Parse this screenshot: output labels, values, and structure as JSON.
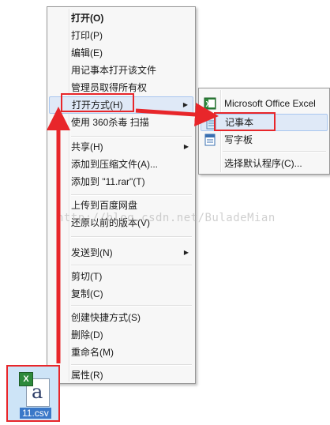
{
  "context_menu": {
    "items": [
      {
        "label": "打开(O)"
      },
      {
        "label": "打印(P)"
      },
      {
        "label": "编辑(E)"
      },
      {
        "label": "用记事本打开该文件"
      },
      {
        "label": "管理员取得所有权"
      },
      {
        "label": "打开方式(H)"
      },
      {
        "label": "使用 360杀毒 扫描"
      },
      {
        "label": "共享(H)"
      },
      {
        "label": "添加到压缩文件(A)..."
      },
      {
        "label": "添加到 \"11.rar\"(T)"
      },
      {
        "label": "上传到百度网盘"
      },
      {
        "label": "还原以前的版本(V)"
      },
      {
        "label": "发送到(N)"
      },
      {
        "label": "剪切(T)"
      },
      {
        "label": "复制(C)"
      },
      {
        "label": "创建快捷方式(S)"
      },
      {
        "label": "删除(D)"
      },
      {
        "label": "重命名(M)"
      },
      {
        "label": "属性(R)"
      }
    ]
  },
  "open_with_submenu": {
    "items": [
      {
        "label": "Microsoft Office Excel",
        "icon": "excel-icon"
      },
      {
        "label": "记事本",
        "icon": "notepad-icon"
      },
      {
        "label": "写字板",
        "icon": "wordpad-icon"
      },
      {
        "label": "选择默认程序(C)..."
      }
    ]
  },
  "file": {
    "name": "11.csv",
    "icon_glyph": "a",
    "excel_glyph": "X"
  },
  "watermark": "http://blog.csdn.net/BuladeMian",
  "colors": {
    "annotation": "#e8262a",
    "highlight": "#dfe9f7",
    "selection": "#3a78c8"
  }
}
